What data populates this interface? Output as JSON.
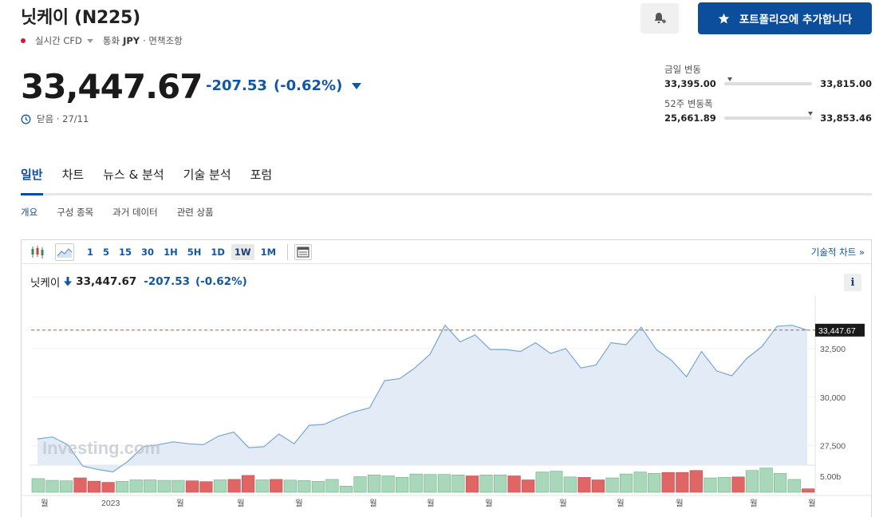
{
  "header": {
    "title": "닛케이 (N225)",
    "realtime_label": "실시간 CFD",
    "currency_label": "통화",
    "currency": "JPY",
    "disclaimer": "· 면책조항",
    "portfolio_button": "포트폴리오에 추가합니다"
  },
  "quote": {
    "price": "33,447.67",
    "change": "-207.53",
    "change_pct": "(-0.62%)",
    "status": "닫음 · 27/11"
  },
  "day_range": {
    "label": "금일 변동",
    "low": "33,395.00",
    "high": "33,815.00",
    "position": 0.04
  },
  "year_range": {
    "label": "52주 변동폭",
    "low": "25,661.89",
    "high": "33,853.46",
    "position": 0.98
  },
  "tabs": [
    "일반",
    "차트",
    "뉴스 & 분석",
    "기술 분석",
    "포럼"
  ],
  "subtabs": [
    "개요",
    "구성 종목",
    "과거 데이터",
    "관련 상품"
  ],
  "toolbar": {
    "intervals": [
      "1",
      "5",
      "15",
      "30",
      "1H",
      "5H",
      "1D",
      "1W",
      "1M"
    ],
    "active_interval": "1W",
    "technical_link": "기술적 차트 »"
  },
  "chart_header": {
    "name": "닛케이",
    "value": "33,447.67",
    "change": "-207.53",
    "change_pct": "(-0.62%)",
    "info": "i"
  },
  "colors": {
    "accent": "#0d4e9c",
    "down_blue": "#1256a6",
    "vol_up": "#a8d8b9",
    "vol_down": "#e06666",
    "area_fill": "#e3ecf6",
    "line": "#7aa6cf"
  },
  "chart_data": {
    "type": "area",
    "watermark": "Investing.com",
    "current_label": "33,447.67",
    "current_value": 33447.67,
    "ylim": [
      26500,
      35000
    ],
    "y_ticks": [
      27500,
      30000,
      32500
    ],
    "y_tick_labels": [
      "27,500",
      "30,000",
      "32,500"
    ],
    "volume_label": "5.00b",
    "x_labels": [
      "월",
      "2023",
      "월",
      "월",
      "월",
      "월",
      "월",
      "월",
      "월",
      "월",
      "월",
      "월",
      "월"
    ],
    "values": [
      27850,
      27950,
      27550,
      26450,
      26280,
      26150,
      26700,
      27450,
      27550,
      27700,
      27600,
      27550,
      28000,
      28200,
      27400,
      27450,
      28100,
      27600,
      28550,
      28600,
      28950,
      29250,
      29450,
      30850,
      30950,
      31500,
      32200,
      33700,
      32850,
      33200,
      32450,
      32450,
      32350,
      32800,
      32250,
      32500,
      31500,
      31650,
      32800,
      32700,
      33600,
      32450,
      31900,
      31050,
      32350,
      31350,
      31100,
      32000,
      32600,
      33650,
      33700,
      33450
    ],
    "volume": [
      55,
      48,
      46,
      58,
      45,
      40,
      44,
      50,
      50,
      48,
      48,
      46,
      43,
      50,
      52,
      68,
      50,
      52,
      49,
      47,
      44,
      52,
      25,
      63,
      70,
      66,
      60,
      74,
      72,
      72,
      70,
      66,
      70,
      70,
      66,
      50,
      82,
      85,
      62,
      60,
      50,
      58,
      74,
      82,
      76,
      80,
      80,
      88,
      58,
      60,
      62,
      88,
      98,
      76,
      52,
      14
    ],
    "volume_down": [
      false,
      false,
      false,
      true,
      true,
      true,
      false,
      false,
      false,
      false,
      false,
      true,
      true,
      false,
      true,
      true,
      false,
      true,
      false,
      false,
      false,
      false,
      false,
      false,
      false,
      false,
      false,
      false,
      false,
      false,
      false,
      true,
      false,
      false,
      true,
      true,
      false,
      false,
      false,
      true,
      true,
      false,
      false,
      false,
      false,
      true,
      true,
      true,
      false,
      false,
      true,
      false,
      false,
      false,
      false,
      true
    ]
  }
}
